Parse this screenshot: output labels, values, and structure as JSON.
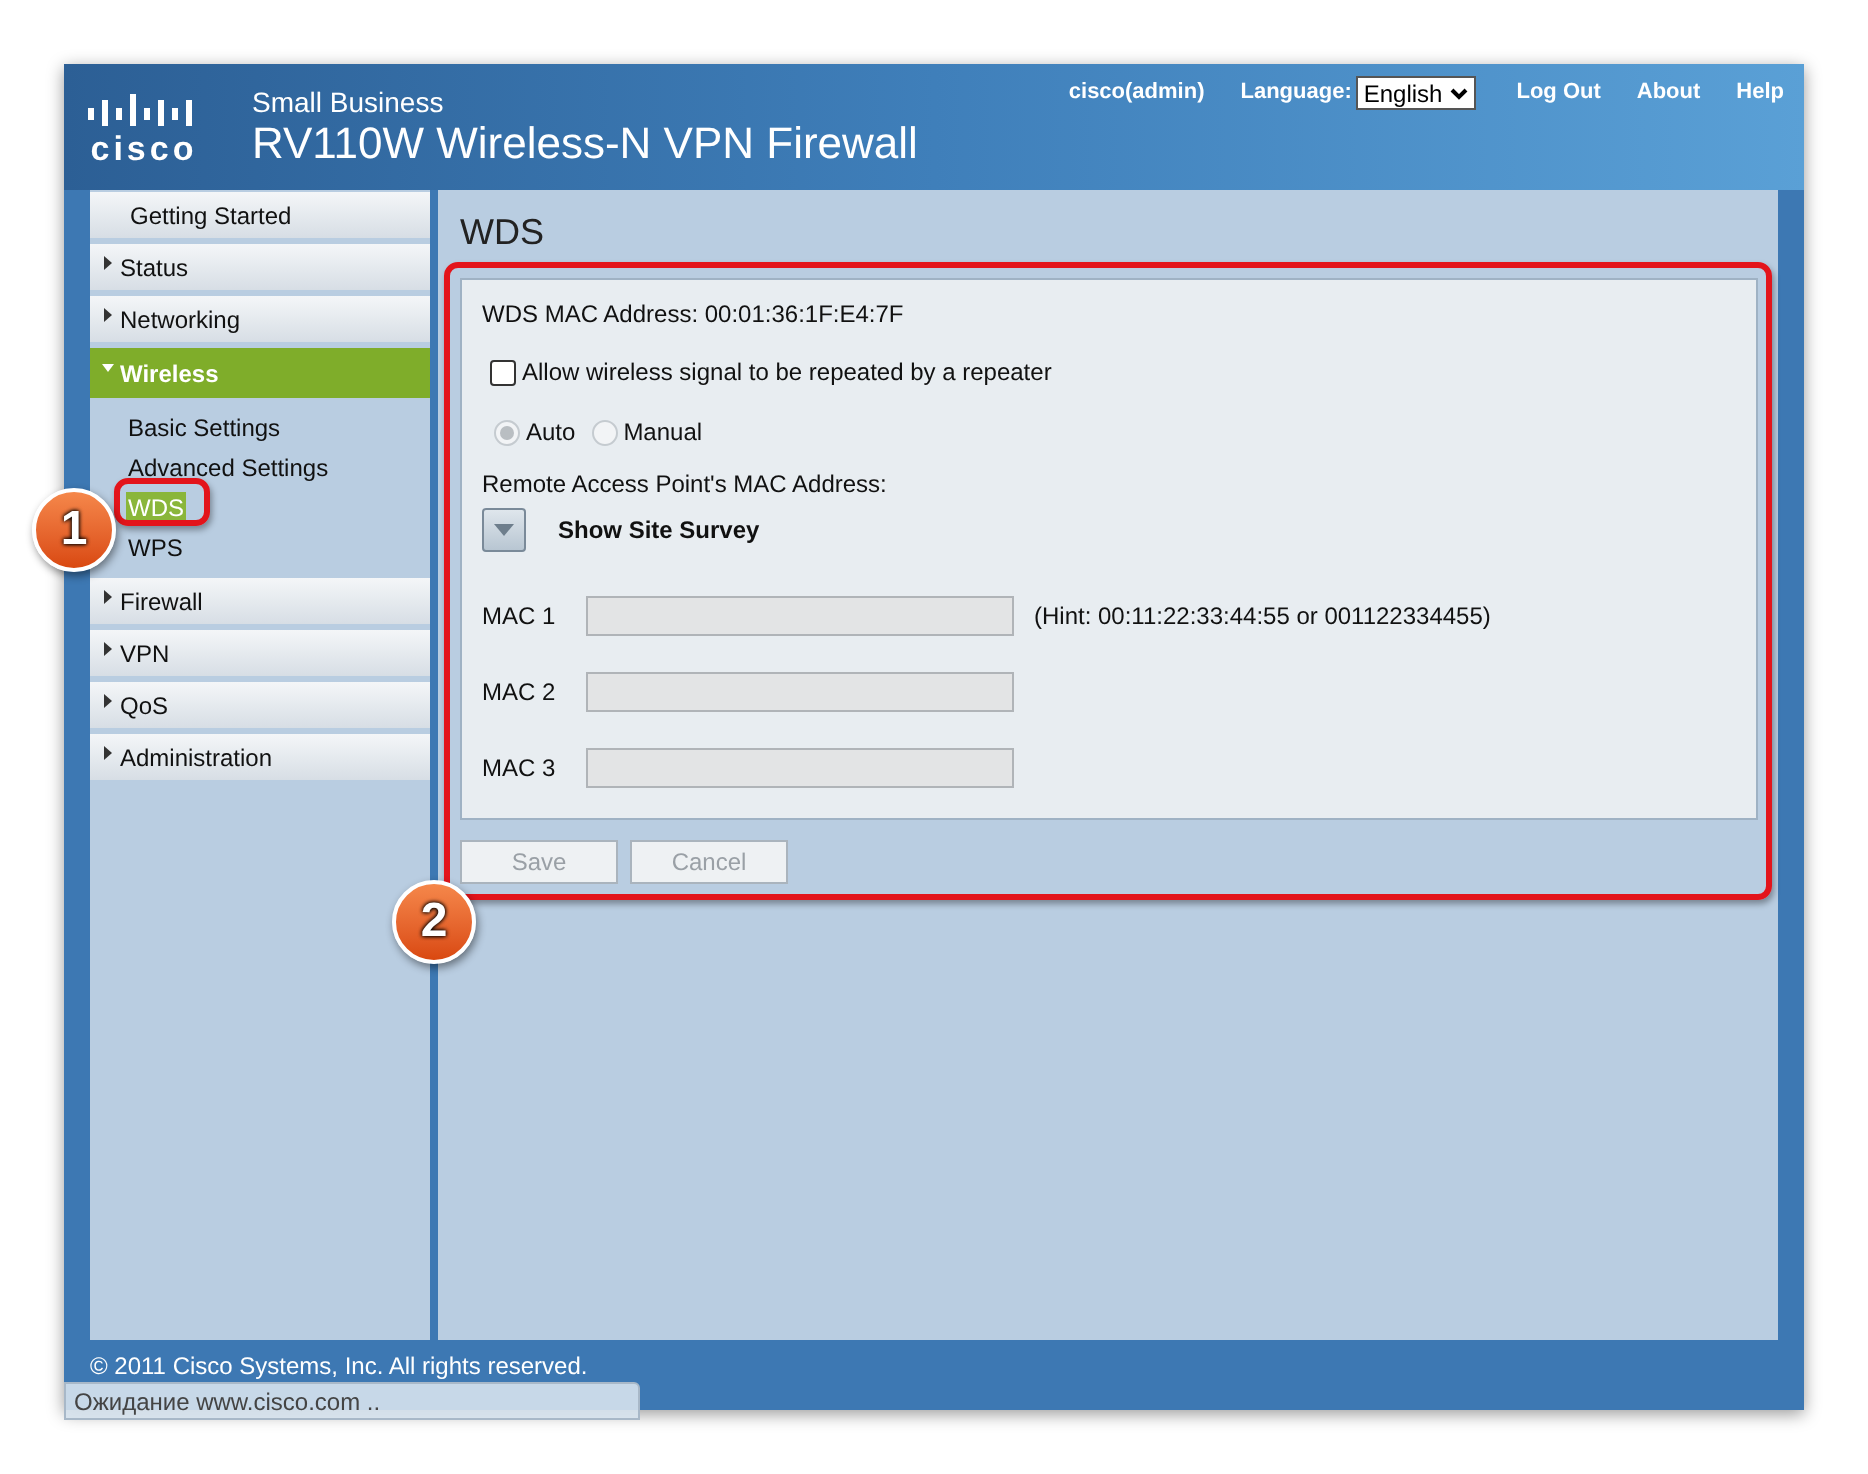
{
  "header": {
    "logo_text": "cisco",
    "product_line": "Small Business",
    "title": "RV110W Wireless-N VPN Firewall",
    "user": "cisco(admin)",
    "language_label": "Language:",
    "language": "English",
    "links": [
      "Log Out",
      "About",
      "Help"
    ]
  },
  "sidebar": {
    "items": [
      {
        "kind": "link",
        "label": "Getting Started",
        "selected": false
      },
      {
        "kind": "section",
        "label": "Status",
        "expanded": false,
        "selected": false
      },
      {
        "kind": "section",
        "label": "Networking",
        "expanded": false,
        "selected": false
      },
      {
        "kind": "section",
        "label": "Wireless",
        "expanded": true,
        "selected": true,
        "children": [
          {
            "label": "Basic Settings",
            "selected": false
          },
          {
            "label": "Advanced Settings",
            "selected": false
          },
          {
            "label": "WDS",
            "selected": true
          },
          {
            "label": "WPS",
            "selected": false
          }
        ]
      },
      {
        "kind": "section",
        "label": "Firewall",
        "expanded": false,
        "selected": false
      },
      {
        "kind": "section",
        "label": "VPN",
        "expanded": false,
        "selected": false
      },
      {
        "kind": "section",
        "label": "QoS",
        "expanded": false,
        "selected": false
      },
      {
        "kind": "section",
        "label": "Administration",
        "expanded": false,
        "selected": false
      }
    ]
  },
  "content": {
    "title": "WDS",
    "mac_address": "WDS MAC Address: 00:01:36:1F:E4:7F",
    "repeater": {
      "label": "Allow wireless signal to be repeated by a repeater",
      "checked": false
    },
    "modes": [
      {
        "label": "Auto",
        "selected": true,
        "disabled": true
      },
      {
        "label": "Manual",
        "selected": false,
        "disabled": true
      }
    ],
    "remote_label": "Remote Access Point's MAC Address:",
    "site_survey": {
      "label": "Show Site Survey",
      "expanded": false
    },
    "mac_fields": [
      {
        "label": "MAC 1",
        "disabled": true,
        "hint": "(Hint: 00:11:22:33:44:55 or 001122334455)"
      },
      {
        "label": "MAC 2",
        "disabled": true
      },
      {
        "label": "MAC 3",
        "disabled": true
      }
    ],
    "buttons": [
      {
        "label": "Save",
        "disabled": true
      },
      {
        "label": "Cancel",
        "disabled": true
      }
    ]
  },
  "footer": {
    "copyright": "© 2011 Cisco Systems, Inc. All rights reserved.",
    "status_text": "Ожидание www.cisco.com .."
  },
  "annotations": [
    {
      "number": "1"
    },
    {
      "number": "2"
    }
  ]
}
